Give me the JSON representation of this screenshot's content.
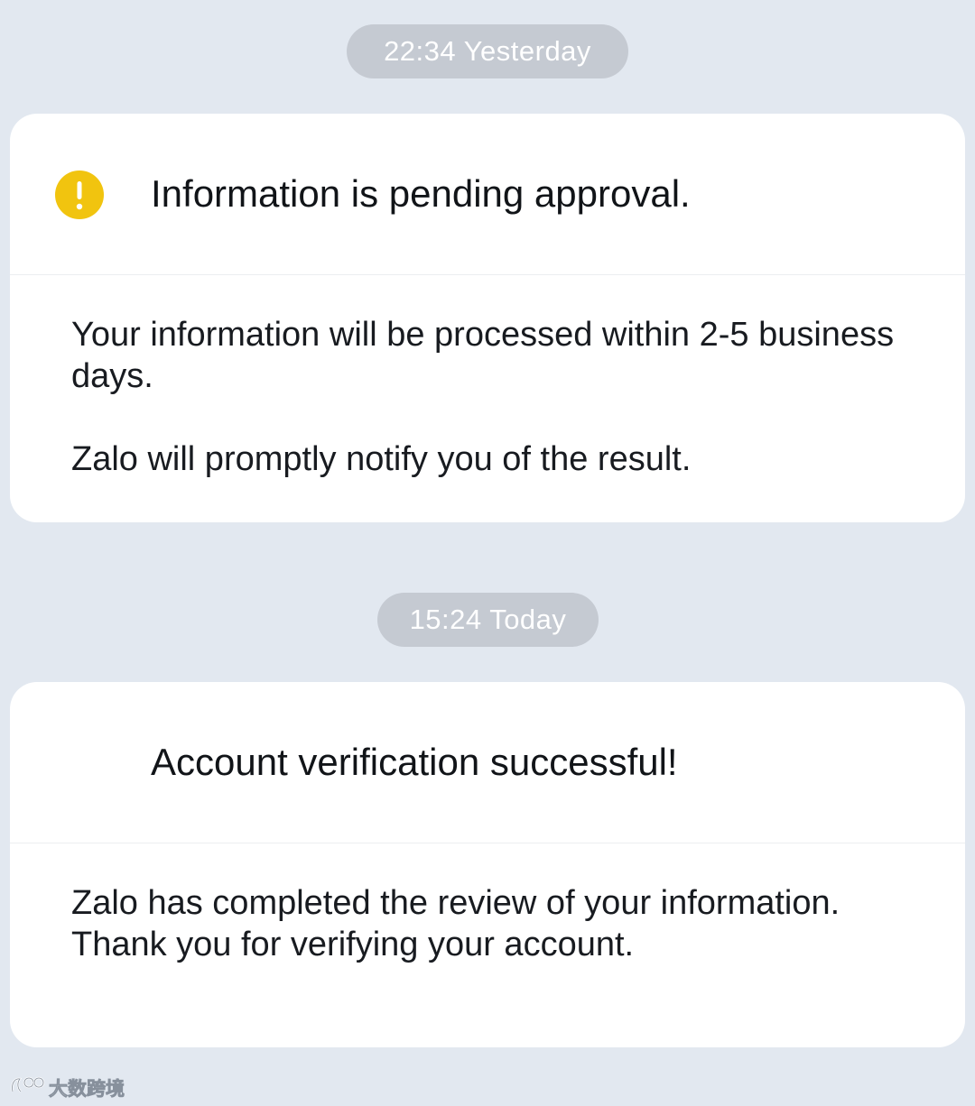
{
  "messages": [
    {
      "timestamp": "22:34 Yesterday",
      "title": "Information is pending approval.",
      "icon": "warning-icon",
      "paragraphs": [
        "Your information will be processed within 2-5 business days.",
        "Zalo will promptly notify you of the result."
      ]
    },
    {
      "timestamp": "15:24 Today",
      "title": "Account verification successful!",
      "paragraphs": [
        "Zalo has completed the review of your information. Thank you for verifying your account."
      ]
    }
  ],
  "watermark": {
    "text": "大数跨境"
  },
  "colors": {
    "background": "#e2e8f0",
    "card": "#ffffff",
    "timestamp_pill": "#c5cad2",
    "warning": "#f1c40f"
  }
}
